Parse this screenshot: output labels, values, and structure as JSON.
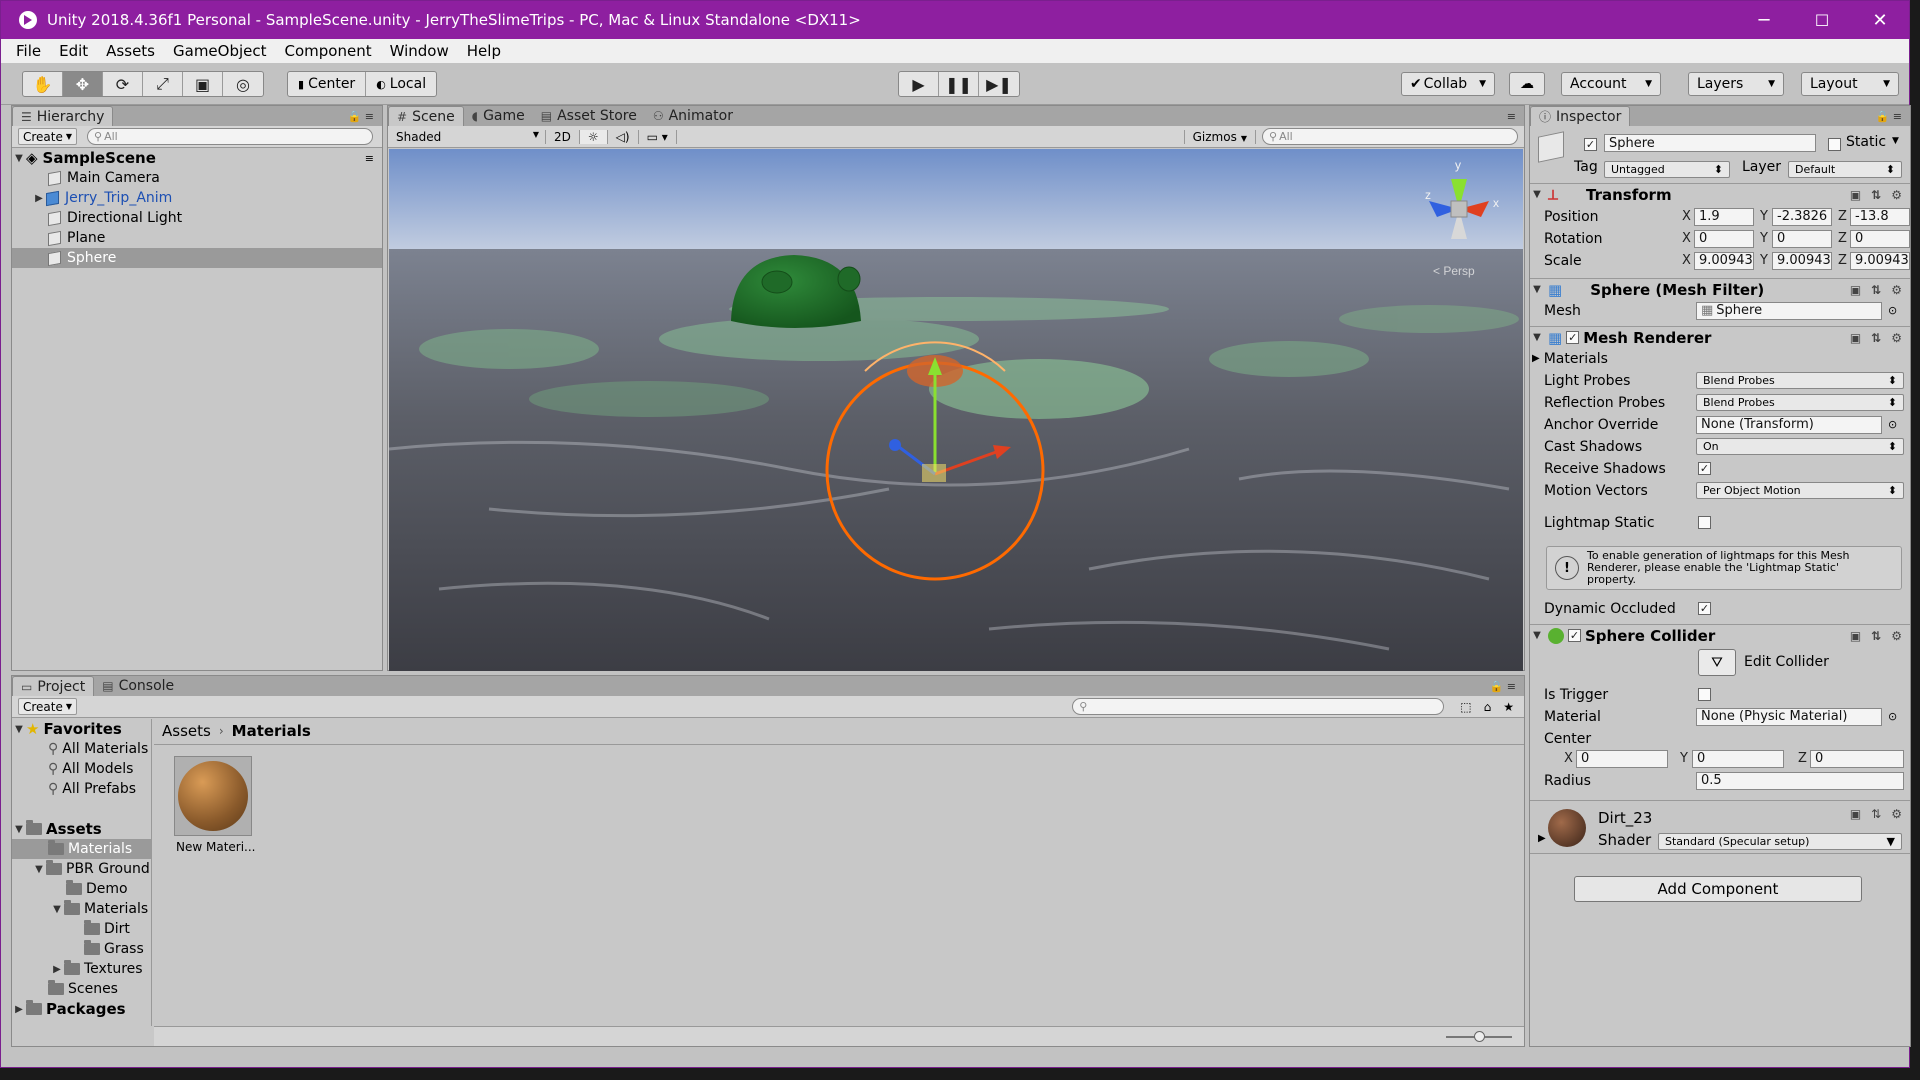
{
  "window": {
    "title": "Unity 2018.4.36f1 Personal - SampleScene.unity - JerryTheSlimeTrips - PC, Mac & Linux Standalone <DX11>",
    "minimize": "─",
    "maximize": "☐",
    "close": "✕"
  },
  "menu": [
    "File",
    "Edit",
    "Assets",
    "GameObject",
    "Component",
    "Window",
    "Help"
  ],
  "toolbar": {
    "pivot": "Center",
    "space": "Local",
    "collab": "Collab",
    "account": "Account",
    "layers": "Layers",
    "layout": "Layout"
  },
  "hierarchy": {
    "tab": "Hierarchy",
    "create": "Create",
    "search_placeholder": "All",
    "scene": "SampleScene",
    "items": [
      {
        "label": "Main Camera",
        "type": "object"
      },
      {
        "label": "Jerry_Trip_Anim",
        "type": "prefab"
      },
      {
        "label": "Directional Light",
        "type": "object"
      },
      {
        "label": "Plane",
        "type": "object"
      },
      {
        "label": "Sphere",
        "type": "object",
        "selected": true
      }
    ]
  },
  "scene": {
    "tabs": [
      "Scene",
      "Game",
      "Asset Store",
      "Animator"
    ],
    "shading": "Shaded",
    "mode_2d": "2D",
    "gizmos": "Gizmos",
    "search_placeholder": "All",
    "persp": "< Persp",
    "axis_y": "y",
    "axis_x": "x",
    "axis_z": "z"
  },
  "inspector": {
    "tab": "Inspector",
    "object_name": "Sphere",
    "static_label": "Static",
    "tag_label": "Tag",
    "tag": "Untagged",
    "layer_label": "Layer",
    "layer": "Default",
    "transform": {
      "title": "Transform",
      "position_label": "Position",
      "position": [
        "1.9",
        "-2.3826",
        "-13.8"
      ],
      "rotation_label": "Rotation",
      "rotation": [
        "0",
        "0",
        "0"
      ],
      "scale_label": "Scale",
      "scale": [
        "9.00943",
        "9.00943",
        "9.00943"
      ]
    },
    "mesh_filter": {
      "title": "Sphere (Mesh Filter)",
      "mesh_label": "Mesh",
      "mesh": "Sphere"
    },
    "mesh_renderer": {
      "title": "Mesh Renderer",
      "materials": "Materials",
      "light_probes_label": "Light Probes",
      "light_probes": "Blend Probes",
      "reflection_probes_label": "Reflection Probes",
      "reflection_probes": "Blend Probes",
      "anchor_label": "Anchor Override",
      "anchor": "None (Transform)",
      "cast_shadows_label": "Cast Shadows",
      "cast_shadows": "On",
      "receive_shadows_label": "Receive Shadows",
      "motion_vectors_label": "Motion Vectors",
      "motion_vectors": "Per Object Motion",
      "lightmap_static_label": "Lightmap Static",
      "info": "To enable generation of lightmaps for this Mesh Renderer, please enable the 'Lightmap Static' property.",
      "dynamic_occluded_label": "Dynamic Occluded"
    },
    "sphere_collider": {
      "title": "Sphere Collider",
      "edit_collider": "Edit Collider",
      "is_trigger_label": "Is Trigger",
      "material_label": "Material",
      "material": "None (Physic Material)",
      "center_label": "Center",
      "center": [
        "0",
        "0",
        "0"
      ],
      "radius_label": "Radius",
      "radius": "0.5"
    },
    "material": {
      "name": "Dirt_23",
      "shader_label": "Shader",
      "shader": "Standard (Specular setup)"
    },
    "add_component": "Add Component"
  },
  "project": {
    "tabs": [
      "Project",
      "Console"
    ],
    "create": "Create",
    "breadcrumb": [
      "Assets",
      "Materials"
    ],
    "favorites": "Favorites",
    "favorite_items": [
      "All Materials",
      "All Models",
      "All Prefabs"
    ],
    "tree": [
      {
        "label": "Assets",
        "level": 0,
        "bold": true
      },
      {
        "label": "Materials",
        "level": 1,
        "selected": true
      },
      {
        "label": "PBR Ground",
        "level": 1
      },
      {
        "label": "Demo",
        "level": 2
      },
      {
        "label": "Materials",
        "level": 2
      },
      {
        "label": "Dirt",
        "level": 3
      },
      {
        "label": "Grass",
        "level": 3
      },
      {
        "label": "Textures",
        "level": 2
      },
      {
        "label": "Scenes",
        "level": 1
      },
      {
        "label": "Packages",
        "level": 0,
        "bold": true
      }
    ],
    "asset": "New Materi..."
  },
  "colors": {
    "titlebar": "#8e1fa0",
    "selection_ring": "#ff6a00"
  }
}
